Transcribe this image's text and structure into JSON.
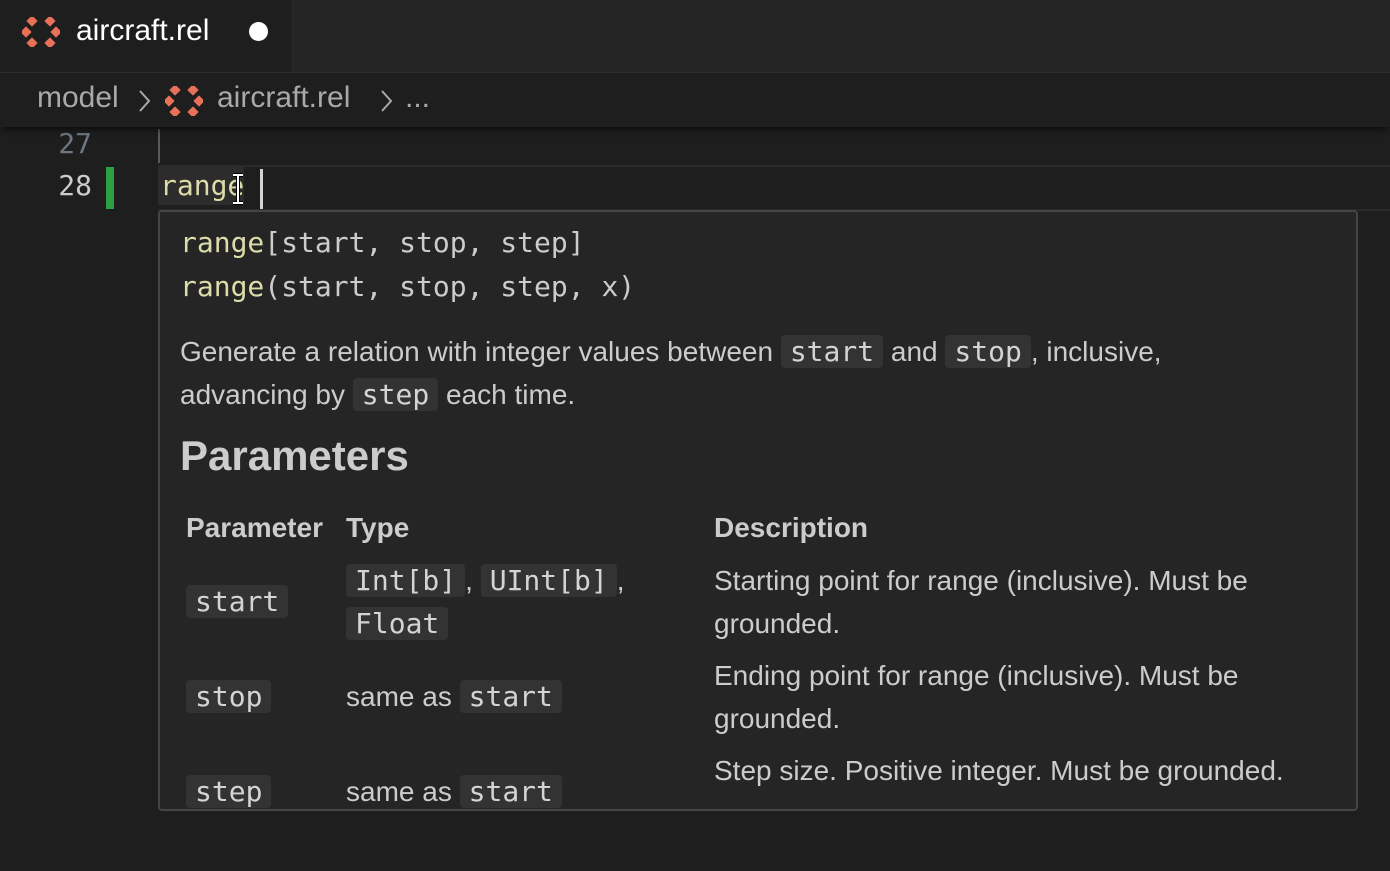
{
  "tab": {
    "title": "aircraft.rel",
    "icon": "rel-file-icon",
    "dirty": true
  },
  "breadcrumb": {
    "items": [
      "model",
      "aircraft.rel",
      "..."
    ]
  },
  "editor": {
    "lines": [
      {
        "number": "27",
        "text": ""
      },
      {
        "number": "28",
        "text": "range"
      }
    ]
  },
  "hover": {
    "signatures": [
      {
        "name": "range",
        "args": "[start, stop, step]"
      },
      {
        "name": "range",
        "args": "(start, stop, step, x)"
      }
    ],
    "description": {
      "part1": "Generate a relation with integer values between ",
      "code1": "start",
      "part2": " and ",
      "code2": "stop",
      "part3": ", inclusive,",
      "part4": "advancing by ",
      "code3": "step",
      "part5": " each time."
    },
    "parameters_heading": "Parameters",
    "table": {
      "headers": [
        "Parameter",
        "Type",
        "Description"
      ],
      "rows": [
        {
          "param": "start",
          "types": [
            "Int[b]",
            "UInt[b]",
            "Float"
          ],
          "description": "Starting point for range (inclusive). Must be grounded."
        },
        {
          "param": "stop",
          "type_text": "same as ",
          "type_code": "start",
          "description": "Ending point for range (inclusive). Must be grounded."
        },
        {
          "param": "step",
          "type_text": "same as ",
          "type_code": "start",
          "description": "Step size. Positive integer. Must be grounded."
        }
      ]
    }
  },
  "colors": {
    "background": "#1e1e1e",
    "hover_bg": "#252526",
    "function": "#dcdcaa",
    "modified_gutter": "#2ea043",
    "logo": "#e8715a"
  }
}
